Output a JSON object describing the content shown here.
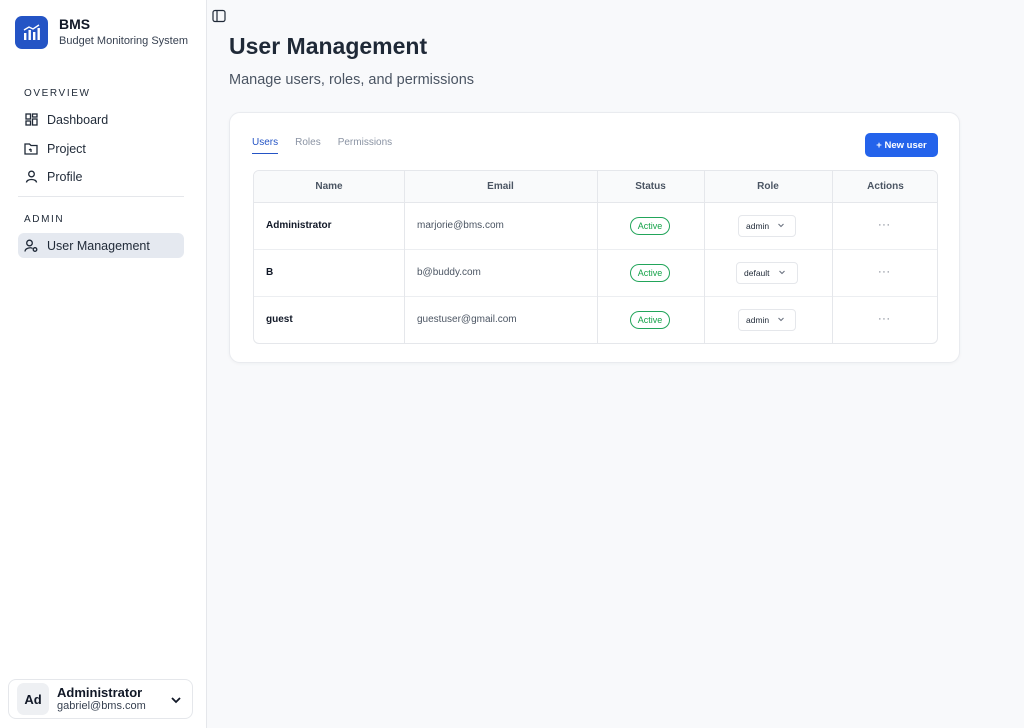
{
  "brand": {
    "title": "BMS",
    "subtitle": "Budget Monitoring System"
  },
  "sidebar": {
    "sections": [
      {
        "label": "OVERVIEW",
        "items": [
          {
            "label": "Dashboard",
            "icon": "dashboard-icon"
          },
          {
            "label": "Project",
            "icon": "folder-icon"
          },
          {
            "label": "Profile",
            "icon": "user-icon"
          }
        ]
      },
      {
        "label": "ADMIN",
        "items": [
          {
            "label": "User Management",
            "icon": "user-settings-icon",
            "active": true
          }
        ]
      }
    ],
    "user": {
      "initials": "Ad",
      "name": "Administrator",
      "email": "gabriel@bms.com"
    }
  },
  "header": {
    "title": "User Management",
    "subtitle": "Manage users, roles, and permissions"
  },
  "tabs": [
    {
      "label": "Users",
      "active": true
    },
    {
      "label": "Roles",
      "active": false
    },
    {
      "label": "Permissions",
      "active": false
    }
  ],
  "new_user_label": "+ New user",
  "table": {
    "columns": [
      "Name",
      "Email",
      "Status",
      "Role",
      "Actions"
    ],
    "rows": [
      {
        "name": "Administrator",
        "email": "marjorie@bms.com",
        "status": "Active",
        "role": "admin",
        "actions": "···"
      },
      {
        "name": "B",
        "email": "b@buddy.com",
        "status": "Active",
        "role": "default",
        "actions": "···"
      },
      {
        "name": "guest",
        "email": "guestuser@gmail.com",
        "status": "Active",
        "role": "admin",
        "actions": "···"
      }
    ]
  },
  "colors": {
    "accent": "#2463eb",
    "brand": "#2454c5",
    "success": "#16a34a"
  }
}
